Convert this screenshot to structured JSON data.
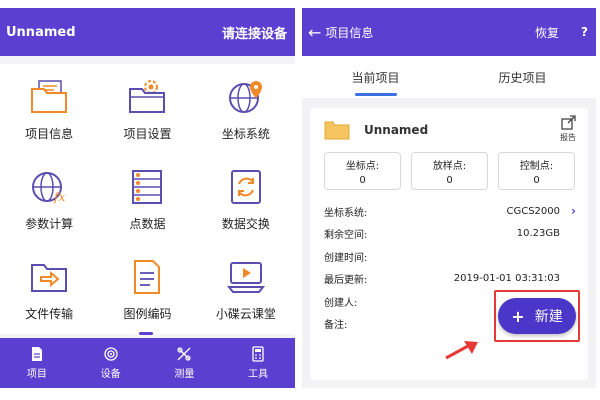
{
  "left": {
    "header": {
      "title": "Unnamed",
      "connect": "请连接设备"
    },
    "grid": [
      {
        "label": "项目信息",
        "icon": "folder-doc-icon"
      },
      {
        "label": "项目设置",
        "icon": "folder-gear-icon"
      },
      {
        "label": "坐标系统",
        "icon": "globe-pin-icon"
      },
      {
        "label": "参数计算",
        "icon": "globe-fx-icon"
      },
      {
        "label": "点数据",
        "icon": "point-list-icon"
      },
      {
        "label": "数据交换",
        "icon": "data-exchange-icon"
      },
      {
        "label": "文件传输",
        "icon": "file-transfer-icon"
      },
      {
        "label": "图例编码",
        "icon": "legend-doc-icon"
      },
      {
        "label": "小碟云课堂",
        "icon": "cloud-classroom-icon"
      }
    ],
    "nav": [
      {
        "label": "项目",
        "icon": "project-icon"
      },
      {
        "label": "设备",
        "icon": "device-icon"
      },
      {
        "label": "测量",
        "icon": "measure-icon"
      },
      {
        "label": "工具",
        "icon": "tools-icon"
      }
    ]
  },
  "right": {
    "header": {
      "back": "←",
      "title": "项目信息",
      "restore": "恢复",
      "help": "?"
    },
    "tabs": [
      {
        "label": "当前项目"
      },
      {
        "label": "历史项目"
      }
    ],
    "project": {
      "name": "Unnamed",
      "report_label": "报告"
    },
    "stats": [
      {
        "label": "坐标点:",
        "value": "0"
      },
      {
        "label": "放样点:",
        "value": "0"
      },
      {
        "label": "控制点:",
        "value": "0"
      }
    ],
    "info": {
      "coord_system": {
        "label": "坐标系统:",
        "value": "CGCS2000"
      },
      "free_space": {
        "label": "剩余空间:",
        "value": "10.23GB"
      },
      "created_time": {
        "label": "创建时间:",
        "value": ""
      },
      "last_updated": {
        "label": "最后更新:",
        "value": "2019-01-01 03:31:03"
      },
      "creator": {
        "label": "创建人:",
        "value": ""
      },
      "notes": {
        "label": "备注:",
        "value": ""
      }
    },
    "new_button": {
      "plus": "+",
      "label": "新建"
    }
  },
  "colors": {
    "primary": "#5b3fd0",
    "accent_orange": "#f08a28",
    "highlight_red": "#e53935",
    "tab_underline": "#3b6fe0"
  }
}
